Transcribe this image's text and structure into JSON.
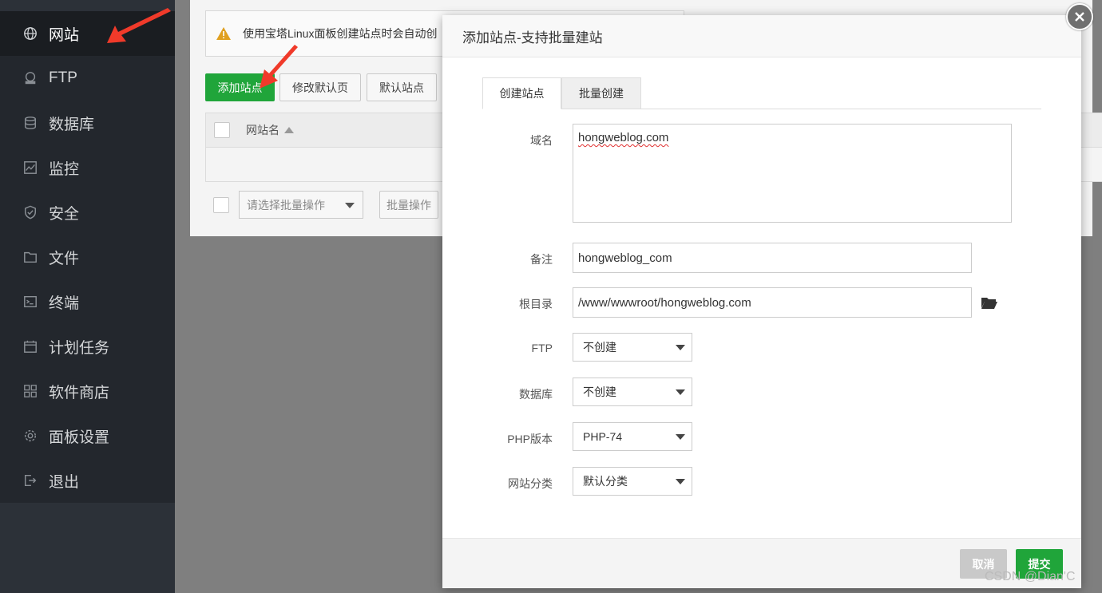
{
  "sidebar": {
    "items": [
      {
        "label": "网站",
        "icon": "globe-icon",
        "active": true
      },
      {
        "label": "FTP",
        "icon": "ftp-icon"
      },
      {
        "label": "数据库",
        "icon": "database-icon"
      },
      {
        "label": "监控",
        "icon": "monitor-icon"
      },
      {
        "label": "安全",
        "icon": "shield-icon"
      },
      {
        "label": "文件",
        "icon": "folder-icon"
      },
      {
        "label": "终端",
        "icon": "terminal-icon"
      },
      {
        "label": "计划任务",
        "icon": "calendar-icon"
      },
      {
        "label": "软件商店",
        "icon": "grid-icon"
      },
      {
        "label": "面板设置",
        "icon": "gear-icon"
      },
      {
        "label": "退出",
        "icon": "logout-icon"
      }
    ]
  },
  "main": {
    "notice": "使用宝塔Linux面板创建站点时会自动创",
    "toolbar": {
      "add_site": "添加站点",
      "modify_default_page": "修改默认页",
      "default_site": "默认站点"
    },
    "table": {
      "col_site_name": "网站名"
    },
    "batch": {
      "select_placeholder": "请选择批量操作",
      "batch_button": "批量操作"
    }
  },
  "dialog": {
    "title": "添加站点-支持批量建站",
    "tabs": [
      "创建站点",
      "批量创建"
    ],
    "fields": {
      "domain_label": "域名",
      "domain_value": "hongweblog.com",
      "remark_label": "备注",
      "remark_value": "hongweblog_com",
      "root_label": "根目录",
      "root_value": "/www/wwwroot/hongweblog.com",
      "ftp_label": "FTP",
      "ftp_value": "不创建",
      "db_label": "数据库",
      "db_value": "不创建",
      "php_label": "PHP版本",
      "php_value": "PHP-74",
      "category_label": "网站分类",
      "category_value": "默认分类"
    },
    "footer": {
      "cancel": "取消",
      "submit": "提交"
    }
  },
  "watermark": "CSDN @Dian'C",
  "colors": {
    "sidebar_bg": "#23272d",
    "accent_green": "#20a53a",
    "arrow_red": "#f03a2a"
  }
}
